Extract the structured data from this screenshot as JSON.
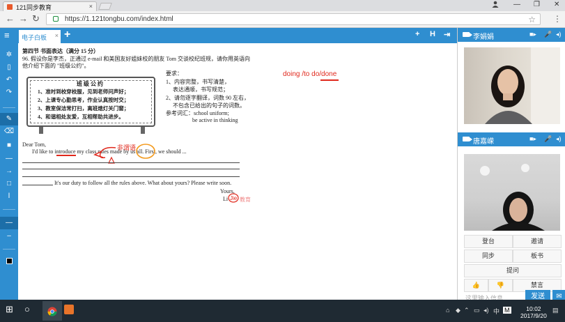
{
  "browser": {
    "tab_title": "121同步教育",
    "tab_close": "×",
    "url": "https://1.121tongbu.com/index.html",
    "minimize": "—",
    "maximize": "❐",
    "close": "✕",
    "user_icon": "user-icon"
  },
  "appbar": {
    "board_tab": "电子白板",
    "board_tab_close": "×",
    "add_tab": "+",
    "right_tools": [
      "+",
      "H",
      "⇥"
    ]
  },
  "left_toolbar": {
    "icons": [
      "gear-icon",
      "trash-icon",
      "undo-icon",
      "redo-icon",
      "pen-icon",
      "eraser-icon",
      "rectangle-icon",
      "line-icon",
      "arrow-icon",
      "circle-icon",
      "text-icon",
      "line-thick-icon",
      "line-thin-icon",
      "color-black-icon"
    ]
  },
  "board": {
    "section_title": "第四节  书面表达（满分 15 分）",
    "prompt_line1": "96. 假设你是李杰，正通过  e-mail  和美国友好姐妹校的朋友  Tom  交谈校纪班规，请你用英语向",
    "prompt_line2": "他介绍下面的 \"班级公约\"。",
    "sign_title": "班 级 公 约",
    "rules": [
      "1、准时到校穿校服，见到老师问声好；",
      "2、上课专心勤思考，作业认真按时交；",
      "3、教室保洁常打扫，离班熄灯关门窗；",
      "4、和谐相处友爱，互相帮助共进步。"
    ],
    "req_title": "要求：",
    "req_items": [
      "1、内容完整，书写清楚，",
      "表达通顺，书写规范；",
      "2、请勿逐字翻译，词数 90 左右，",
      "不包含已给出的句子的词数。",
      "参考词汇：school uniform;",
      "be active in thinking"
    ],
    "annotation_red": "doing /to do/done",
    "greeting": "Dear Tom,",
    "body_line1": "I'd like to introduce my class rules made by us all. First, we should ...",
    "handwritten_note": "非谓语",
    "closing_line": "It's our duty to follow all the rules above. What about yours? Please write soon.",
    "yours": "Yours,",
    "signature": "Li",
    "signature_note": "Jie",
    "watermark": "教育"
  },
  "panel": {
    "teacher_name": "李娟娟",
    "student_name": "唐嘉嵘",
    "buttons": {
      "stage": "登台",
      "invite": "邀请",
      "sync": "同步",
      "blackboard": "板书",
      "question": "提问",
      "mute": "禁言"
    },
    "chat_placeholder": "这里输入信息",
    "send": "发送"
  },
  "taskbar": {
    "time": "10:02",
    "date": "2017/9/20"
  }
}
